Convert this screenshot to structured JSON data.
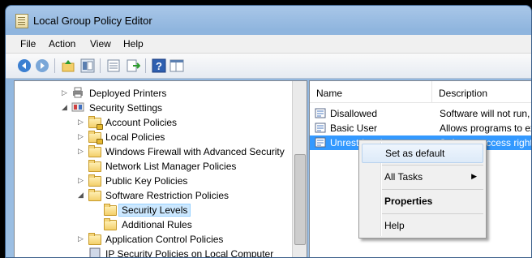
{
  "window": {
    "title": "Local Group Policy Editor"
  },
  "menu": [
    "File",
    "Action",
    "View",
    "Help"
  ],
  "toolbar": {
    "icons": [
      "back-arrow-icon",
      "forward-arrow-icon",
      "up-folder-icon",
      "show-hide-tree-icon",
      "properties-icon",
      "export-list-icon",
      "help-icon",
      "show-pane-icon"
    ]
  },
  "tree": [
    {
      "label": "Deployed Printers",
      "icon": "printer-icon",
      "expander": "collapsed"
    },
    {
      "label": "Security Settings",
      "icon": "security-settings-icon",
      "expander": "expanded"
    },
    {
      "label": "Account Policies",
      "icon": "folder-lock-icon",
      "expander": "collapsed"
    },
    {
      "label": "Local Policies",
      "icon": "folder-lock-icon",
      "expander": "collapsed"
    },
    {
      "label": "Windows Firewall with Advanced Security",
      "icon": "folder-icon",
      "expander": "collapsed"
    },
    {
      "label": "Network List Manager Policies",
      "icon": "folder-icon",
      "expander": "none"
    },
    {
      "label": "Public Key Policies",
      "icon": "folder-icon",
      "expander": "collapsed"
    },
    {
      "label": "Software Restriction Policies",
      "icon": "folder-icon",
      "expander": "expanded"
    },
    {
      "label": "Security Levels",
      "icon": "folder-icon",
      "expander": "none",
      "selected": true
    },
    {
      "label": "Additional Rules",
      "icon": "folder-icon",
      "expander": "none"
    },
    {
      "label": "Application Control Policies",
      "icon": "folder-icon",
      "expander": "collapsed"
    },
    {
      "label": "IP Security Policies on Local Computer",
      "icon": "ip-security-icon",
      "expander": "none"
    }
  ],
  "list": {
    "columns": [
      "Name",
      "Description"
    ],
    "rows": [
      {
        "name": "Disallowed",
        "description": "Software will not run, r",
        "icon": "security-level-icon"
      },
      {
        "name": "Basic User",
        "description": "Allows programs to exe",
        "icon": "security-level-icon"
      },
      {
        "name": "Unrestricted",
        "description": "Software access rights",
        "icon": "security-level-icon",
        "selected": true
      }
    ]
  },
  "context_menu": {
    "items": [
      "Set as default",
      "All Tasks",
      "Properties",
      "Help"
    ]
  },
  "colors": {
    "selection": "#3399ff",
    "title_bar": "#a9c7e8"
  }
}
